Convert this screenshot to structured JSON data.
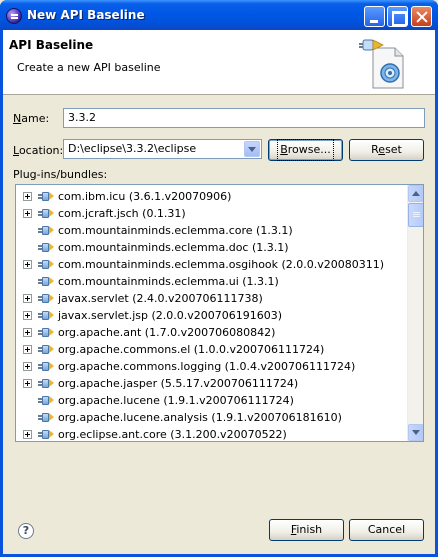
{
  "window": {
    "title": "New API Baseline"
  },
  "banner": {
    "title": "API Baseline",
    "message": "Create a new API baseline"
  },
  "form": {
    "name_label_u": "N",
    "name_label_rest": "ame:",
    "name_value": "3.3.2",
    "location_label_u": "L",
    "location_label_rest": "ocation:",
    "location_value": "D:\\eclipse\\3.3.2\\eclipse",
    "browse_label_u": "B",
    "browse_label_rest": "rowse...",
    "reset_label_pre": "R",
    "reset_label_u": "e",
    "reset_label_rest": "set",
    "plugins_label": "Plug-ins/bundles:"
  },
  "plugins": [
    {
      "label": "com.ibm.icu (3.6.1.v20070906)",
      "expandable": true
    },
    {
      "label": "com.jcraft.jsch (0.1.31)",
      "expandable": true
    },
    {
      "label": "com.mountainminds.eclemma.core (1.3.1)",
      "expandable": false
    },
    {
      "label": "com.mountainminds.eclemma.doc (1.3.1)",
      "expandable": false
    },
    {
      "label": "com.mountainminds.eclemma.osgihook (2.0.0.v20080311)",
      "expandable": true
    },
    {
      "label": "com.mountainminds.eclemma.ui (1.3.1)",
      "expandable": false
    },
    {
      "label": "javax.servlet (2.4.0.v200706111738)",
      "expandable": true
    },
    {
      "label": "javax.servlet.jsp (2.0.0.v200706191603)",
      "expandable": true
    },
    {
      "label": "org.apache.ant (1.7.0.v200706080842)",
      "expandable": true
    },
    {
      "label": "org.apache.commons.el (1.0.0.v200706111724)",
      "expandable": true
    },
    {
      "label": "org.apache.commons.logging (1.0.4.v200706111724)",
      "expandable": true
    },
    {
      "label": "org.apache.jasper (5.5.17.v200706111724)",
      "expandable": true
    },
    {
      "label": "org.apache.lucene (1.9.1.v200706111724)",
      "expandable": false
    },
    {
      "label": "org.apache.lucene.analysis (1.9.1.v200706181610)",
      "expandable": false
    },
    {
      "label": "org.eclipse.ant.core (3.1.200.v20070522)",
      "expandable": true
    }
  ],
  "footer": {
    "help_glyph": "?",
    "finish_label_u": "F",
    "finish_label_rest": "inish",
    "cancel_label": "Cancel"
  }
}
